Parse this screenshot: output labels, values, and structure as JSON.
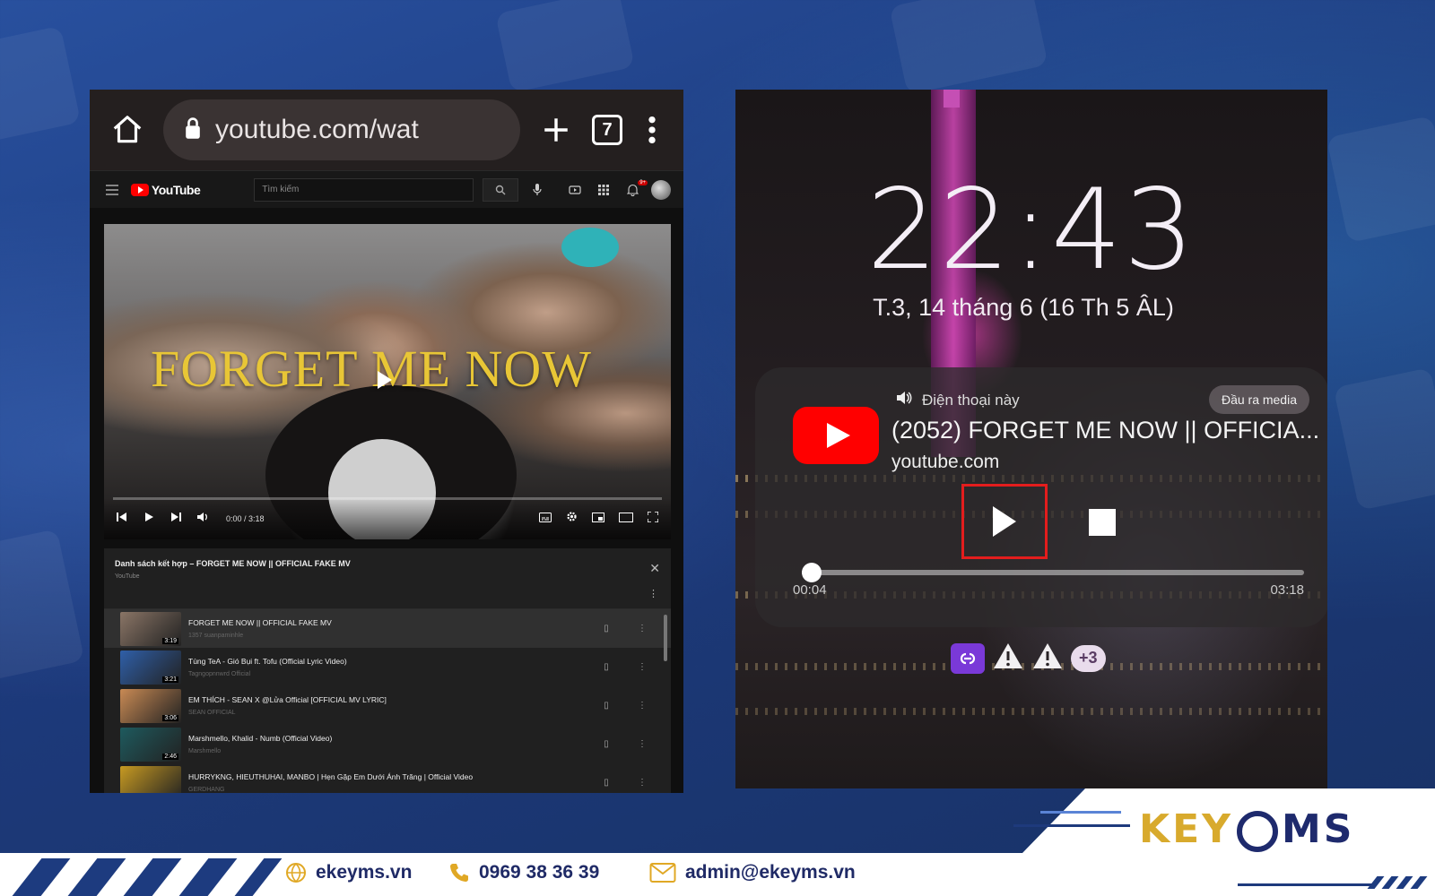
{
  "browser": {
    "url": "youtube.com/wat",
    "tab_count": "7"
  },
  "youtube": {
    "logo_text": "YouTube",
    "search_placeholder": "Tìm kiếm",
    "notification_badge": "9+",
    "video_title_overlay": "FORGET ME NOW",
    "time": "0:00 / 3:18"
  },
  "playlist": {
    "title": "Danh sách kết hợp – FORGET ME NOW || OFFICIAL FAKE MV",
    "subtitle": "YouTube",
    "items": [
      {
        "title": "FORGET ME NOW || OFFICIAL FAKE MV",
        "channel": "1357 suanpaminhle",
        "duration": "3:19",
        "thumb_color": "#8a7566"
      },
      {
        "title": "Tùng TeA - Gió Bụi ft. Tofu (Official Lyric Video)",
        "channel": "Tagngopnnwrd Official",
        "duration": "3:21",
        "thumb_color": "#2f5fa8"
      },
      {
        "title": "EM THÍCH - SEAN X @Lửa Official [OFFICIAL MV LYRIC]",
        "channel": "SEAN OFFICIAL",
        "duration": "3:06",
        "thumb_color": "#c98a54"
      },
      {
        "title": "Marshmello, Khalid - Numb (Official Video)",
        "channel": "Marshmello",
        "duration": "2:46",
        "thumb_color": "#1e5a5e"
      },
      {
        "title": "HURRYKNG, HIEUTHUHAI, MANBO | Hẹn Gặp Em Dưới Ánh Trăng | Official Video",
        "channel": "GERDHANG",
        "duration": "",
        "thumb_color": "#c79a22"
      }
    ]
  },
  "lockscreen": {
    "time": "22:43",
    "date": "T.3, 14 tháng 6 (16 Th 5 ÂL)",
    "media": {
      "device": "Điện thoại này",
      "output_button": "Đầu ra media",
      "title": "(2052) FORGET ME NOW || OFFICIA...",
      "source": "youtube.com",
      "elapsed": "00:04",
      "total": "03:18",
      "progress": 0.02
    },
    "notification_more": "+3"
  },
  "footer": {
    "website": "ekeyms.vn",
    "phone": "0969 38 36 39",
    "email": "admin@ekeyms.vn",
    "logo_left": "KEY",
    "logo_right": "MS"
  },
  "colors": {
    "accent_red": "#e31d1d",
    "youtube_red": "#ff0000",
    "brand_gold": "#d8aa2d",
    "brand_navy": "#1e2a6d"
  }
}
